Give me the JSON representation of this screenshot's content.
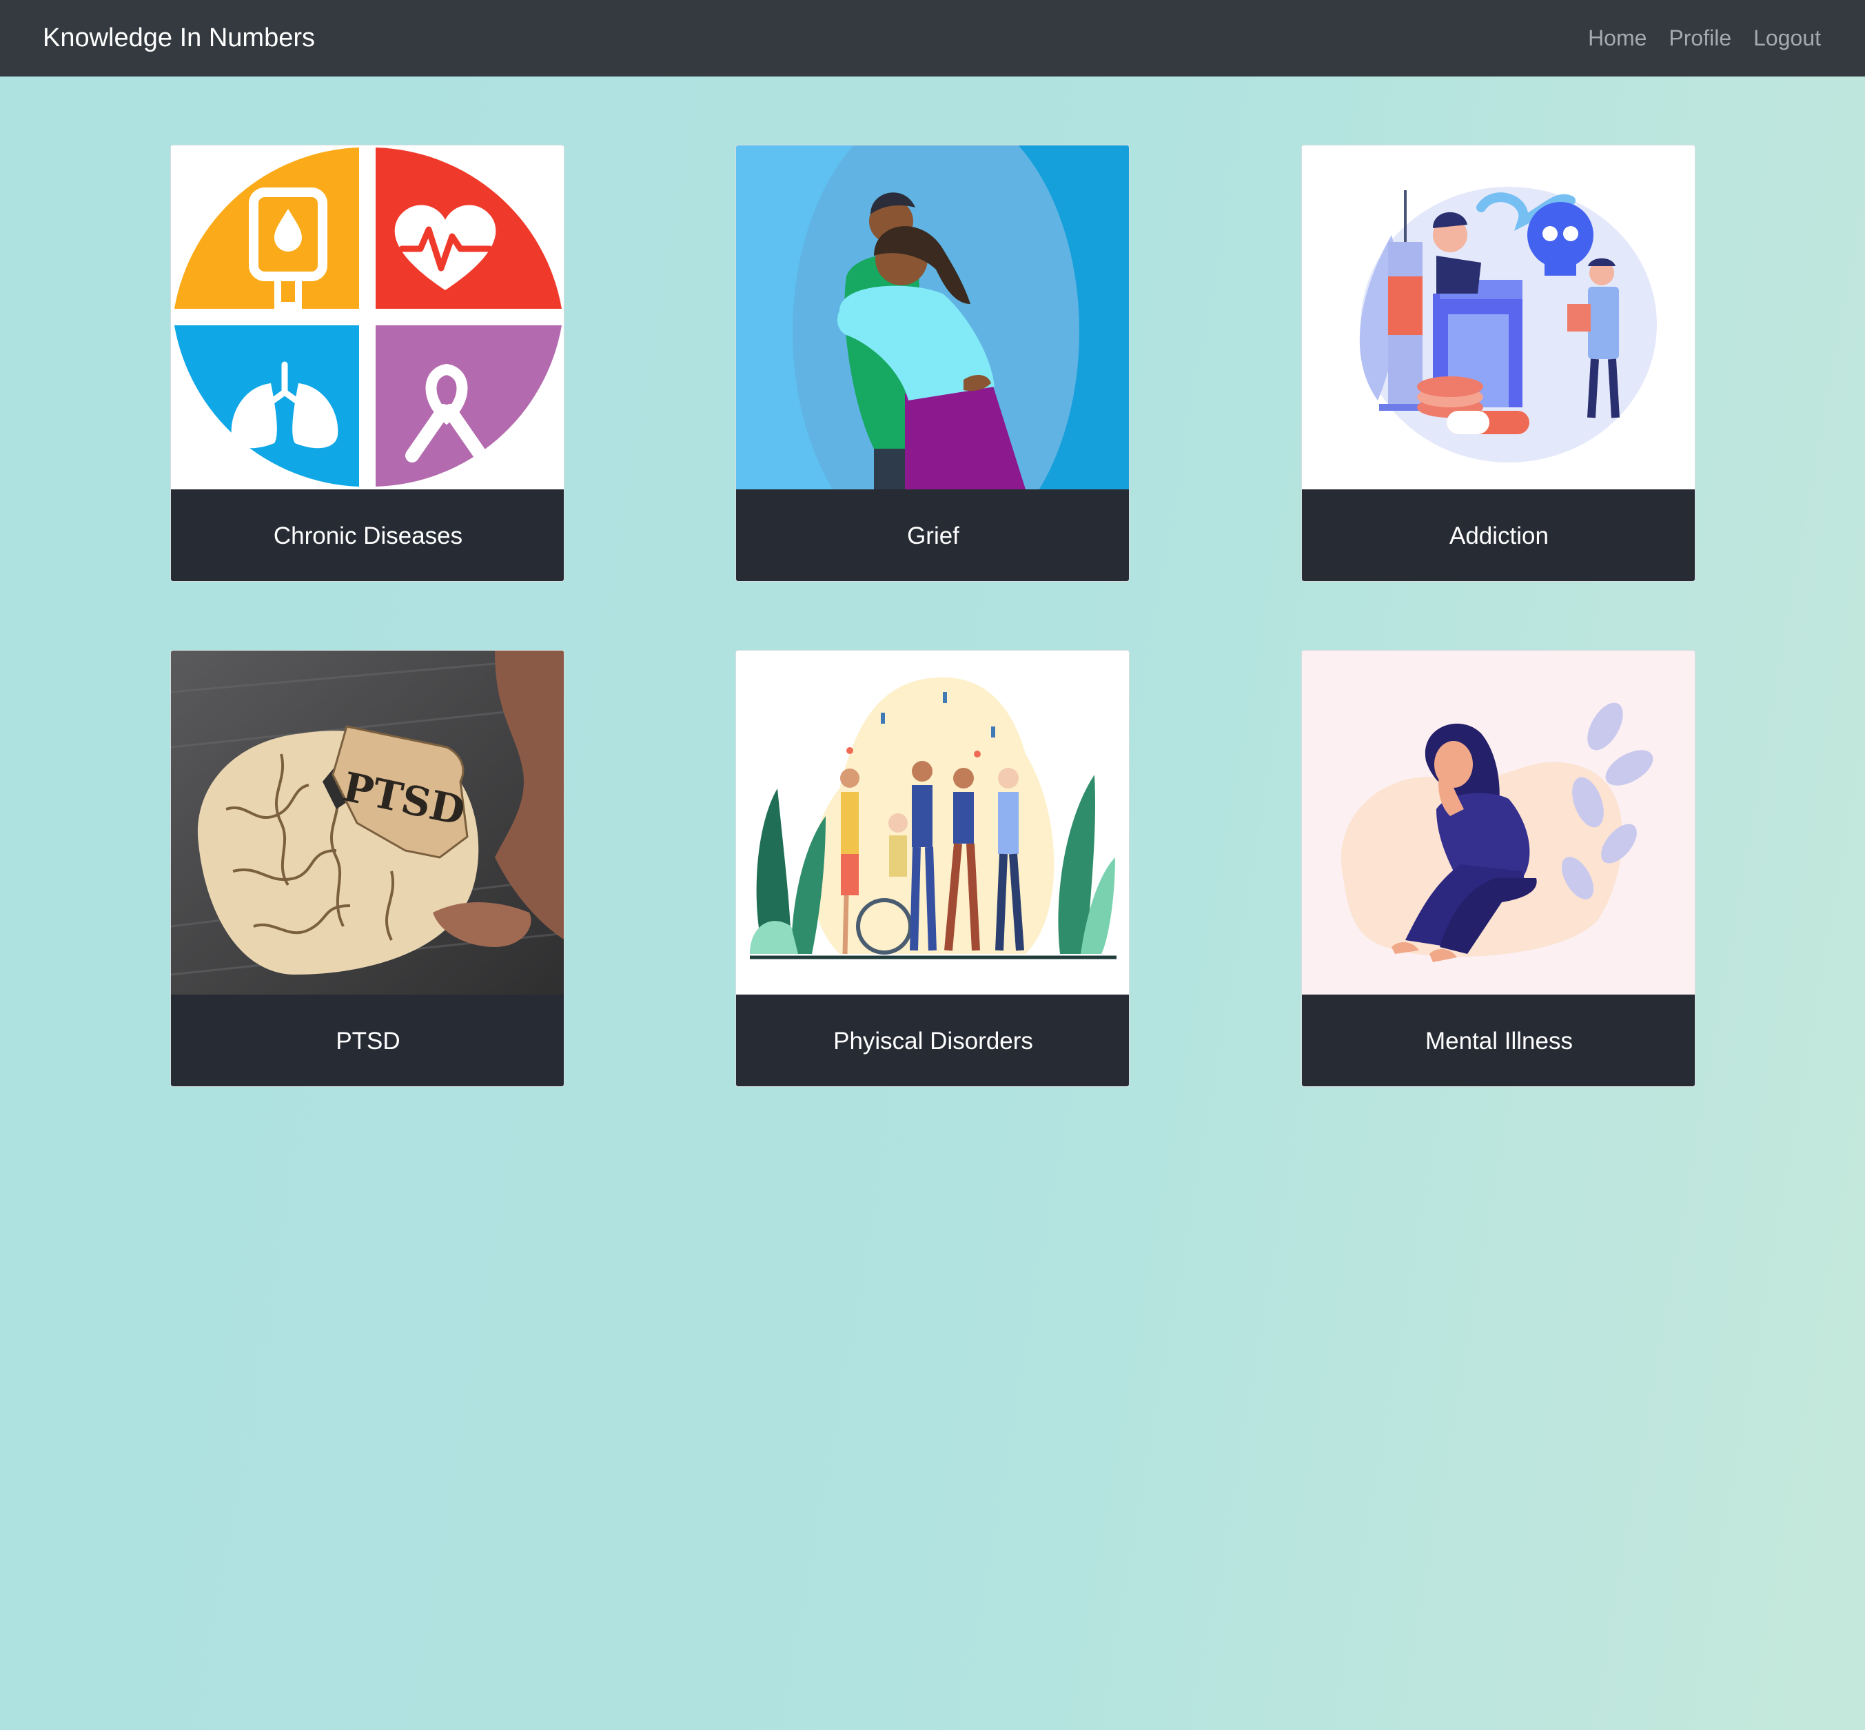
{
  "navbar": {
    "brand": "Knowledge In Numbers",
    "links": [
      "Home",
      "Profile",
      "Logout"
    ]
  },
  "cards": [
    {
      "title": "Chronic Diseases",
      "image_icon": "chronic-diseases-quadrant-icon"
    },
    {
      "title": "Grief",
      "image_icon": "hugging-people-illustration"
    },
    {
      "title": "Addiction",
      "image_icon": "addiction-syringe-skull-illustration"
    },
    {
      "title": "PTSD",
      "image_icon": "puzzle-brain-photo",
      "image_text": "PTSD"
    },
    {
      "title": "Phyiscal Disorders",
      "image_icon": "diverse-group-wheelchair-illustration"
    },
    {
      "title": "Mental Illness",
      "image_icon": "sad-sitting-woman-illustration"
    }
  ],
  "colors": {
    "navbar": "#343a40",
    "card_footer": "#272b34",
    "background_start": "#ade2e1",
    "background_end": "#c5e8dc"
  }
}
